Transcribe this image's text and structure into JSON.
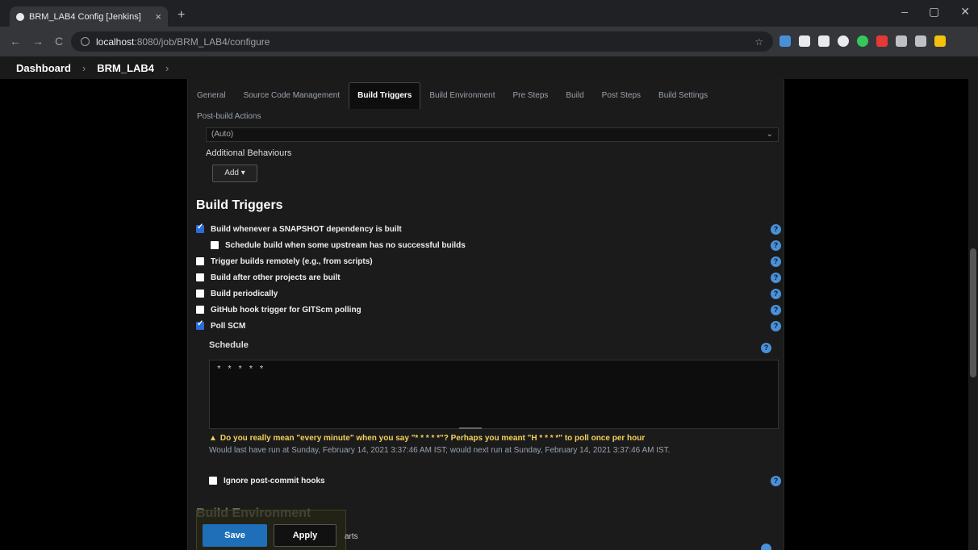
{
  "browser": {
    "tab_title": "BRM_LAB4 Config [Jenkins]",
    "tab_close": "×",
    "new_tab": "+",
    "win_min": "–",
    "win_max": "▢",
    "win_close": "✕",
    "url_host": "localhost",
    "url_path": ":8080/job/BRM_LAB4/configure",
    "back": "←",
    "forward": "→",
    "reload": "C",
    "star": "☆",
    "ext_colors": [
      "#4a90d9",
      "#e8eaed",
      "#e8eaed",
      "#e8eaed",
      "#34c759",
      "#e53935",
      "#bdc1c6",
      "#bdc1c6",
      "#f4c20d"
    ]
  },
  "breadcrumb": {
    "dashboard": "Dashboard",
    "sep1": "›",
    "job": "BRM_LAB4",
    "sep2": "›"
  },
  "tabs": [
    {
      "label": "General"
    },
    {
      "label": "Source Code Management"
    },
    {
      "label": "Build Triggers"
    },
    {
      "label": "Build Environment"
    },
    {
      "label": "Pre Steps"
    },
    {
      "label": "Build"
    },
    {
      "label": "Post Steps"
    },
    {
      "label": "Build Settings"
    },
    {
      "label": "Post-build Actions"
    }
  ],
  "scm": {
    "selected": "(Auto)",
    "chev": "⌄",
    "additional_behaviours": "Additional Behaviours",
    "add_button": "Add ▾"
  },
  "build_triggers": {
    "title": "Build Triggers",
    "options": [
      {
        "label": "Build whenever a SNAPSHOT dependency is built",
        "checked": true
      },
      {
        "label": "Schedule build when some upstream has no successful builds",
        "checked": false,
        "indent": true
      },
      {
        "label": "Trigger builds remotely (e.g., from scripts)",
        "checked": false
      },
      {
        "label": "Build after other projects are built",
        "checked": false
      },
      {
        "label": "Build periodically",
        "checked": false
      },
      {
        "label": "GitHub hook trigger for GITScm polling",
        "checked": false
      },
      {
        "label": "Poll SCM",
        "checked": true
      }
    ],
    "help_glyph": "?",
    "schedule_label": "Schedule",
    "schedule_value": "* * * * *",
    "warning_icon": "▲",
    "warning": "Do you really mean \"every minute\" when you say \"* * * * *\"? Perhaps you meant \"H * * * *\" to poll once per hour",
    "next_run": "Would last have run at Sunday, February 14, 2021 3:37:46 AM IST; would next run at Sunday, February 14, 2021 3:37:46 AM IST.",
    "ignore_hooks": "Ignore post-commit hooks"
  },
  "build_environment": {
    "title": "Build Environment",
    "partial": "arts"
  },
  "footer": {
    "save": "Save",
    "apply": "Apply"
  }
}
